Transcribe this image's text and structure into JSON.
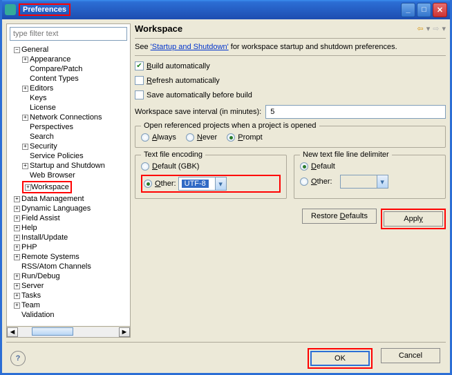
{
  "window": {
    "title": "Preferences"
  },
  "filter": {
    "placeholder": "type filter text"
  },
  "tree": {
    "root0": {
      "label": "General",
      "expand": "−"
    },
    "general": [
      {
        "label": "Appearance",
        "exp": "+"
      },
      {
        "label": "Compare/Patch"
      },
      {
        "label": "Content Types"
      },
      {
        "label": "Editors",
        "exp": "+"
      },
      {
        "label": "Keys"
      },
      {
        "label": "License"
      },
      {
        "label": "Network Connections",
        "exp": "+"
      },
      {
        "label": "Perspectives"
      },
      {
        "label": "Search"
      },
      {
        "label": "Security",
        "exp": "+"
      },
      {
        "label": "Service Policies"
      },
      {
        "label": "Startup and Shutdown",
        "exp": "+"
      },
      {
        "label": "Web Browser"
      },
      {
        "label": "Workspace",
        "exp": "+"
      }
    ],
    "after": [
      {
        "label": "Data Management",
        "exp": "+"
      },
      {
        "label": "Dynamic Languages",
        "exp": "+"
      },
      {
        "label": "Field Assist",
        "exp": "+"
      },
      {
        "label": "Help",
        "exp": "+"
      },
      {
        "label": "Install/Update",
        "exp": "+"
      },
      {
        "label": "PHP",
        "exp": "+"
      },
      {
        "label": "Remote Systems",
        "exp": "+"
      },
      {
        "label": "RSS/Atom Channels"
      },
      {
        "label": "Run/Debug",
        "exp": "+"
      },
      {
        "label": "Server",
        "exp": "+"
      },
      {
        "label": "Tasks",
        "exp": "+"
      },
      {
        "label": "Team",
        "exp": "+"
      },
      {
        "label": "Validation"
      }
    ]
  },
  "page": {
    "title": "Workspace",
    "intro_pre": "See ",
    "intro_link": "'Startup and Shutdown'",
    "intro_post": " for workspace startup and shutdown preferences.",
    "build_label": "Build automatically",
    "refresh_label": "Refresh automatically",
    "saveauto_label": "Save automatically before build",
    "interval_label": "Workspace save interval (in minutes):",
    "interval_value": "5",
    "openref_legend": "Open referenced projects when a project is opened",
    "radio_always": "Always",
    "radio_never": "Never",
    "radio_prompt": "Prompt",
    "enc_legend": "Text file encoding",
    "enc_default": "Default (GBK)",
    "enc_other": "Other:",
    "enc_value": "UTF-8",
    "delim_legend": "New text file line delimiter",
    "delim_default": "Default",
    "delim_other": "Other:",
    "restore": "Restore Defaults",
    "apply": "Apply",
    "ok": "OK",
    "cancel": "Cancel"
  },
  "underline": {
    "b": "B",
    "uild": "uild automatically",
    "r": "R",
    "efresh": "efresh automatically",
    "a2": "A",
    "lways": "lways",
    "n": "N",
    "ever": "ever",
    "p": "P",
    "rompt": "rompt",
    "d": "D",
    "efault_gbk": "efault (GBK)",
    "o": "O",
    "ther": "ther:",
    "d2": "D",
    "efault2": "efault",
    "o2": "O",
    "ther2": "ther:",
    "rd_d": "D",
    "rd_rest": "Restore ",
    "rd_efaults": "efaults",
    "ap_rest": "Appl",
    "ap_y": "y"
  }
}
